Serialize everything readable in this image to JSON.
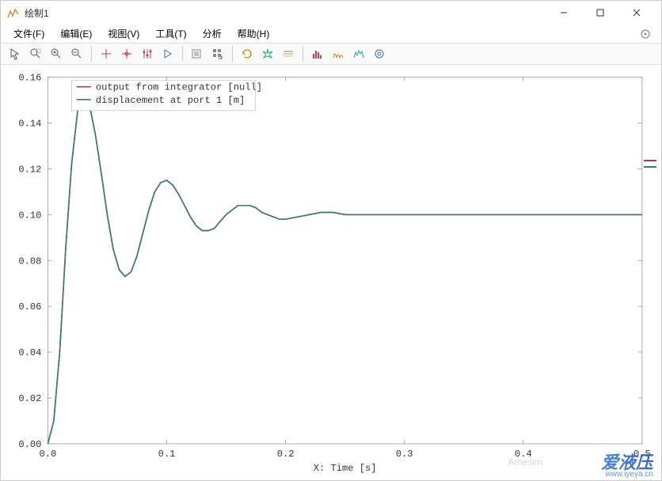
{
  "window": {
    "title": "绘制1"
  },
  "menu": {
    "file": "文件(F)",
    "edit": "编辑(E)",
    "view": "视图(V)",
    "tools": "工具(T)",
    "analysis": "分析",
    "help": "帮助(H)"
  },
  "chart_data": {
    "type": "line",
    "xlabel": "X: Time [s]",
    "ylabel": "",
    "xlim": [
      0.0,
      0.5
    ],
    "ylim": [
      0.0,
      0.16
    ],
    "xticks": [
      0.0,
      0.1,
      0.2,
      0.3,
      0.4,
      0.5
    ],
    "yticks": [
      0.0,
      0.02,
      0.04,
      0.06,
      0.08,
      0.1,
      0.12,
      0.14,
      0.16
    ],
    "legend": {
      "entries": [
        {
          "label": "output from integrator [null]",
          "color": "#b23a3a"
        },
        {
          "label": "displacement at port 1 [m]",
          "color": "#3a7a7a"
        }
      ]
    },
    "series": [
      {
        "name": "output from integrator [null]",
        "color": "#b23a3a",
        "x": [
          0.0,
          0.005,
          0.01,
          0.015,
          0.02,
          0.025,
          0.03,
          0.035,
          0.04,
          0.045,
          0.05,
          0.055,
          0.06,
          0.065,
          0.07,
          0.075,
          0.08,
          0.085,
          0.09,
          0.095,
          0.1,
          0.105,
          0.11,
          0.115,
          0.12,
          0.125,
          0.13,
          0.135,
          0.14,
          0.145,
          0.15,
          0.155,
          0.16,
          0.165,
          0.17,
          0.175,
          0.18,
          0.185,
          0.19,
          0.195,
          0.2,
          0.21,
          0.22,
          0.23,
          0.24,
          0.25,
          0.26,
          0.27,
          0.28,
          0.29,
          0.3,
          0.32,
          0.34,
          0.36,
          0.38,
          0.4,
          0.42,
          0.44,
          0.46,
          0.48,
          0.5
        ],
        "y": [
          0.0,
          0.01,
          0.04,
          0.085,
          0.122,
          0.145,
          0.152,
          0.148,
          0.135,
          0.118,
          0.1,
          0.085,
          0.076,
          0.073,
          0.075,
          0.082,
          0.092,
          0.102,
          0.11,
          0.114,
          0.115,
          0.113,
          0.109,
          0.104,
          0.099,
          0.095,
          0.093,
          0.093,
          0.094,
          0.097,
          0.1,
          0.102,
          0.104,
          0.104,
          0.104,
          0.103,
          0.101,
          0.1,
          0.099,
          0.098,
          0.098,
          0.099,
          0.1,
          0.101,
          0.101,
          0.1,
          0.1,
          0.1,
          0.1,
          0.1,
          0.1,
          0.1,
          0.1,
          0.1,
          0.1,
          0.1,
          0.1,
          0.1,
          0.1,
          0.1,
          0.1
        ]
      },
      {
        "name": "displacement at port 1 [m]",
        "color": "#3a7a7a",
        "x": [
          0.0,
          0.005,
          0.01,
          0.015,
          0.02,
          0.025,
          0.03,
          0.035,
          0.04,
          0.045,
          0.05,
          0.055,
          0.06,
          0.065,
          0.07,
          0.075,
          0.08,
          0.085,
          0.09,
          0.095,
          0.1,
          0.105,
          0.11,
          0.115,
          0.12,
          0.125,
          0.13,
          0.135,
          0.14,
          0.145,
          0.15,
          0.155,
          0.16,
          0.165,
          0.17,
          0.175,
          0.18,
          0.185,
          0.19,
          0.195,
          0.2,
          0.21,
          0.22,
          0.23,
          0.24,
          0.25,
          0.26,
          0.27,
          0.28,
          0.29,
          0.3,
          0.32,
          0.34,
          0.36,
          0.38,
          0.4,
          0.42,
          0.44,
          0.46,
          0.48,
          0.5
        ],
        "y": [
          0.0,
          0.01,
          0.04,
          0.085,
          0.122,
          0.145,
          0.152,
          0.148,
          0.135,
          0.118,
          0.1,
          0.085,
          0.076,
          0.073,
          0.075,
          0.082,
          0.092,
          0.102,
          0.11,
          0.114,
          0.115,
          0.113,
          0.109,
          0.104,
          0.099,
          0.095,
          0.093,
          0.093,
          0.094,
          0.097,
          0.1,
          0.102,
          0.104,
          0.104,
          0.104,
          0.103,
          0.101,
          0.1,
          0.099,
          0.098,
          0.098,
          0.099,
          0.1,
          0.101,
          0.101,
          0.1,
          0.1,
          0.1,
          0.1,
          0.1,
          0.1,
          0.1,
          0.1,
          0.1,
          0.1,
          0.1,
          0.1,
          0.1,
          0.1,
          0.1,
          0.1
        ]
      }
    ]
  },
  "watermark": {
    "brand": "爱液压",
    "url": "www.iyeya.cn",
    "wechat": "Amesim"
  }
}
